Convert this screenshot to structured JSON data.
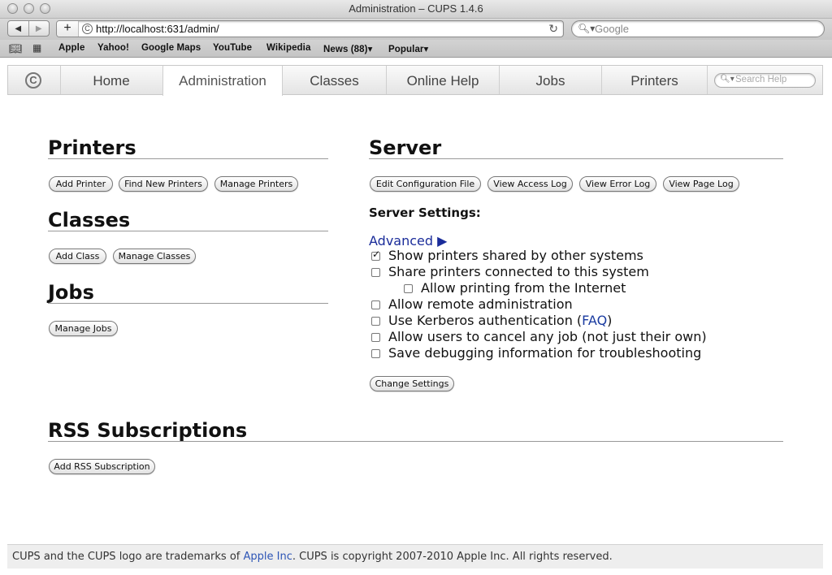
{
  "window": {
    "title": "Administration – CUPS 1.4.6"
  },
  "browser": {
    "url": "http://localhost:631/admin/",
    "search_placeholder": "Google",
    "bookmarks": [
      "Apple",
      "Yahoo!",
      "Google Maps",
      "YouTube",
      "Wikipedia",
      "News (88)▾",
      "Popular▾"
    ]
  },
  "tabs": {
    "logo": "C",
    "items": [
      "Home",
      "Administration",
      "Classes",
      "Online Help",
      "Jobs",
      "Printers"
    ],
    "active": "Administration",
    "search_placeholder": "Search Help"
  },
  "printers": {
    "heading": "Printers",
    "buttons": [
      "Add Printer",
      "Find New Printers",
      "Manage Printers"
    ]
  },
  "classes": {
    "heading": "Classes",
    "buttons": [
      "Add Class",
      "Manage Classes"
    ]
  },
  "jobs": {
    "heading": "Jobs",
    "buttons": [
      "Manage Jobs"
    ]
  },
  "server": {
    "heading": "Server",
    "buttons": [
      "Edit Configuration File",
      "View Access Log",
      "View Error Log",
      "View Page Log"
    ],
    "settings_label": "Server Settings:",
    "advanced": "Advanced ▶",
    "options": [
      {
        "label": "Show printers shared by other systems",
        "checked": true
      },
      {
        "label": "Share printers connected to this system",
        "checked": false
      },
      {
        "label": "Allow printing from the Internet",
        "checked": false
      },
      {
        "label": "Allow remote administration",
        "checked": false
      },
      {
        "label": "Use Kerberos authentication (",
        "link": "FAQ",
        "suffix": ")",
        "checked": false
      },
      {
        "label": "Allow users to cancel any job (not just their own)",
        "checked": false
      },
      {
        "label": "Save debugging information for troubleshooting",
        "checked": false
      }
    ],
    "change_button": "Change Settings"
  },
  "rss": {
    "heading": "RSS Subscriptions",
    "button": "Add RSS Subscription"
  },
  "footer": {
    "text_before": "CUPS and the CUPS logo are trademarks of ",
    "link": "Apple Inc",
    "text_after": ". CUPS is copyright 2007-2010 Apple Inc. All rights reserved."
  }
}
